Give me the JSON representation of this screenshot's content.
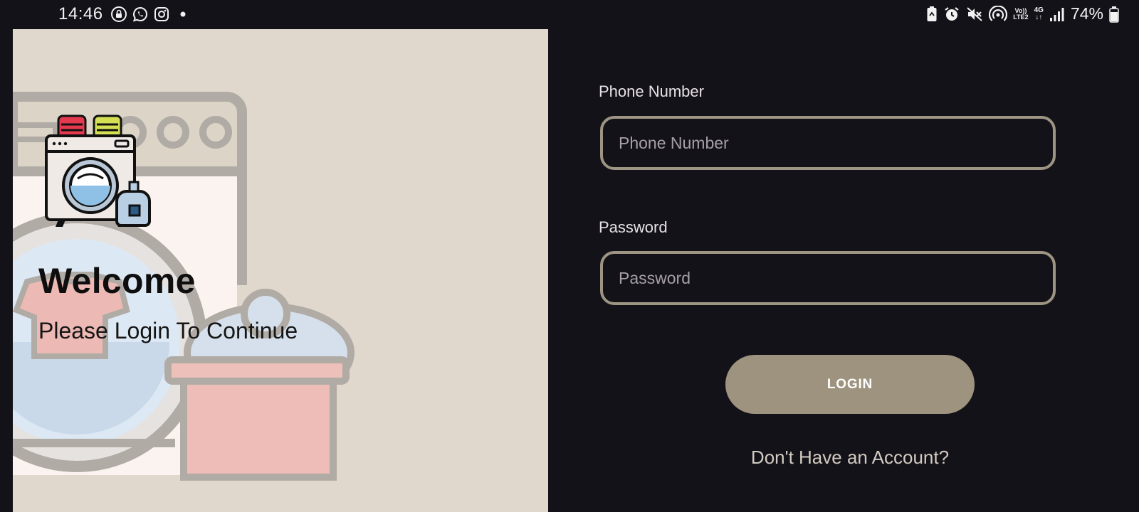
{
  "status_bar": {
    "time": "14:46",
    "battery_percent": "74%",
    "volte_line1": "Vo))",
    "volte_line2": "LTE2",
    "network_type": "4G",
    "left_icons": [
      "lock-icon",
      "whatsapp-icon",
      "instagram-icon",
      "dot-icon"
    ],
    "right_icons": [
      "battery-saver-icon",
      "alarm-icon",
      "mute-icon",
      "hotspot-icon",
      "volte-icon",
      "network-4g-icon",
      "signal-icon",
      "battery-icon"
    ]
  },
  "welcome": {
    "title": "Welcome",
    "subtitle": "Please Login To Continue"
  },
  "form": {
    "phone": {
      "label": "Phone Number",
      "placeholder": "Phone Number",
      "value": ""
    },
    "password": {
      "label": "Password",
      "placeholder": "Password",
      "value": ""
    },
    "login_label": "LOGIN",
    "signup_link": "Don't Have an Account?"
  },
  "colors": {
    "background": "#141219",
    "left_panel": "#e1d8cd",
    "accent": "#9e937e",
    "field_border": "#9d9483",
    "text_light": "#e6e1e6"
  }
}
